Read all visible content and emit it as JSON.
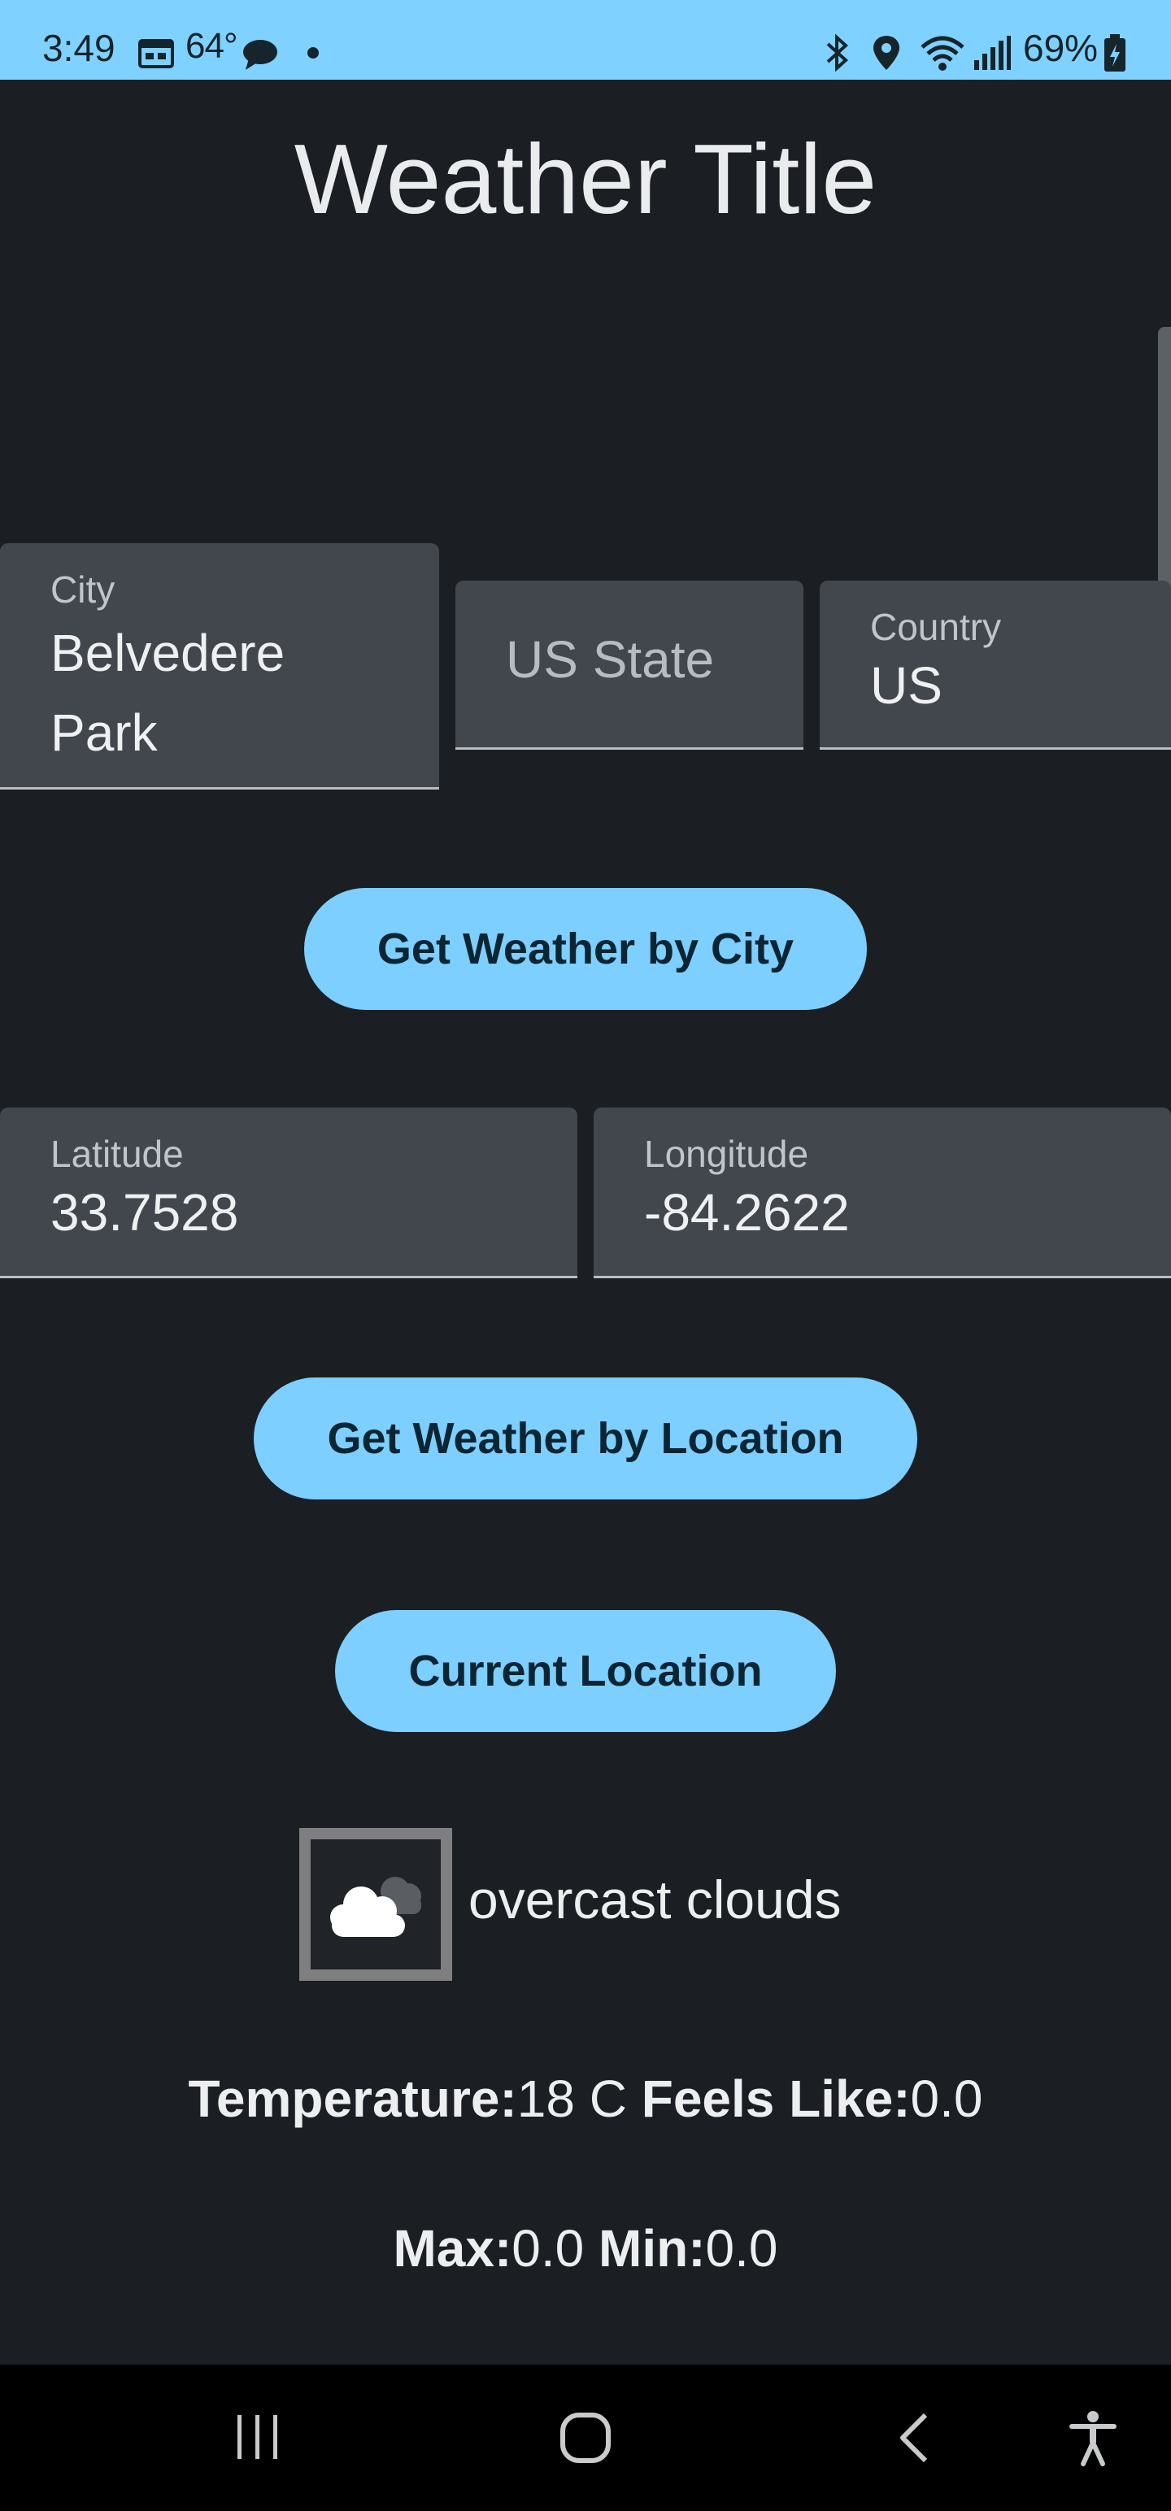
{
  "status_bar": {
    "time": "3:49",
    "temperature": "64°",
    "battery": "69%",
    "background": "#7fd2ff"
  },
  "title": "Weather Title",
  "city_field": {
    "label": "City",
    "value_line1": "Belvedere",
    "value_line2": "Park"
  },
  "state_field": {
    "placeholder": "US State"
  },
  "country_field": {
    "label": "Country",
    "value": "US"
  },
  "get_by_city_button": "Get Weather by City",
  "latitude_field": {
    "label": "Latitude",
    "value": "33.7528"
  },
  "longitude_field": {
    "label": "Longitude",
    "value": "-84.2622"
  },
  "get_by_location_button": "Get Weather by Location",
  "current_location_button": "Current Location",
  "weather": {
    "icon": "overcast-cloud-icon",
    "description": "overcast clouds",
    "temperature_label": "Temperature:",
    "temperature_value": "18 C",
    "feels_like_label": "Feels Like:",
    "feels_like_value": "0.0",
    "max_label": "Max:",
    "max_value": "0.0",
    "min_label": "Min:",
    "min_value": "0.0"
  },
  "colors": {
    "accent": "#7ccfff",
    "background": "#1b1e22",
    "field": "#42474d"
  }
}
